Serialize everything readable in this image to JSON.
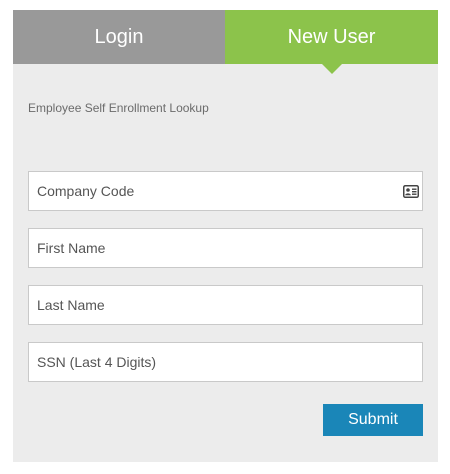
{
  "tabs": {
    "login_label": "Login",
    "new_user_label": "New User",
    "active": "new_user"
  },
  "form": {
    "subtitle": "Employee Self Enrollment Lookup",
    "company_code": {
      "placeholder": "Company Code",
      "value": "",
      "icon": "id-card-icon"
    },
    "first_name": {
      "placeholder": "First Name",
      "value": ""
    },
    "last_name": {
      "placeholder": "Last Name",
      "value": ""
    },
    "ssn": {
      "placeholder": "SSN (Last 4 Digits)",
      "value": ""
    },
    "submit_label": "Submit"
  },
  "colors": {
    "tab_inactive": "#999999",
    "tab_active": "#8cc34b",
    "panel_background": "#ececec",
    "submit_button": "#1a86b8"
  }
}
